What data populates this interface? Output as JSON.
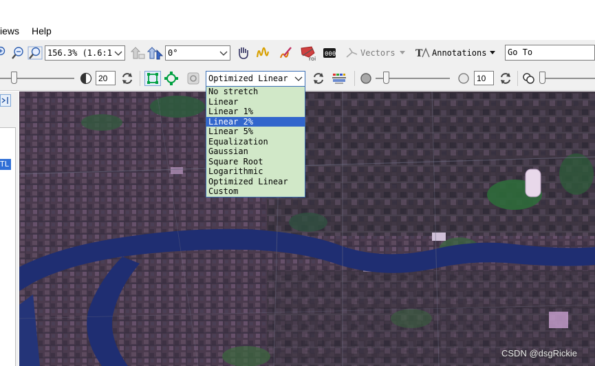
{
  "menu": {
    "views": "iews",
    "help": "Help"
  },
  "toolbar1": {
    "zoom_value": "156.3% (1.6:1",
    "rotation_value": "0°",
    "vectors_label": "Vectors",
    "annotations_label": "Annotations",
    "goto_value": "Go To"
  },
  "toolbar2": {
    "brightness_value": "20",
    "stretch_selected": "Optimized Linear",
    "transparency_value": "10"
  },
  "stretch_options": [
    "No stretch",
    "Linear",
    "Linear 1%",
    "Linear 2%",
    "Linear 5%",
    "Equalization",
    "Gaussian",
    "Square Root",
    "Logarithmic",
    "Optimized Linear",
    "Custom"
  ],
  "left_panel": {
    "selected_label": "TL"
  },
  "watermark": "CSDN @dsgRickie"
}
